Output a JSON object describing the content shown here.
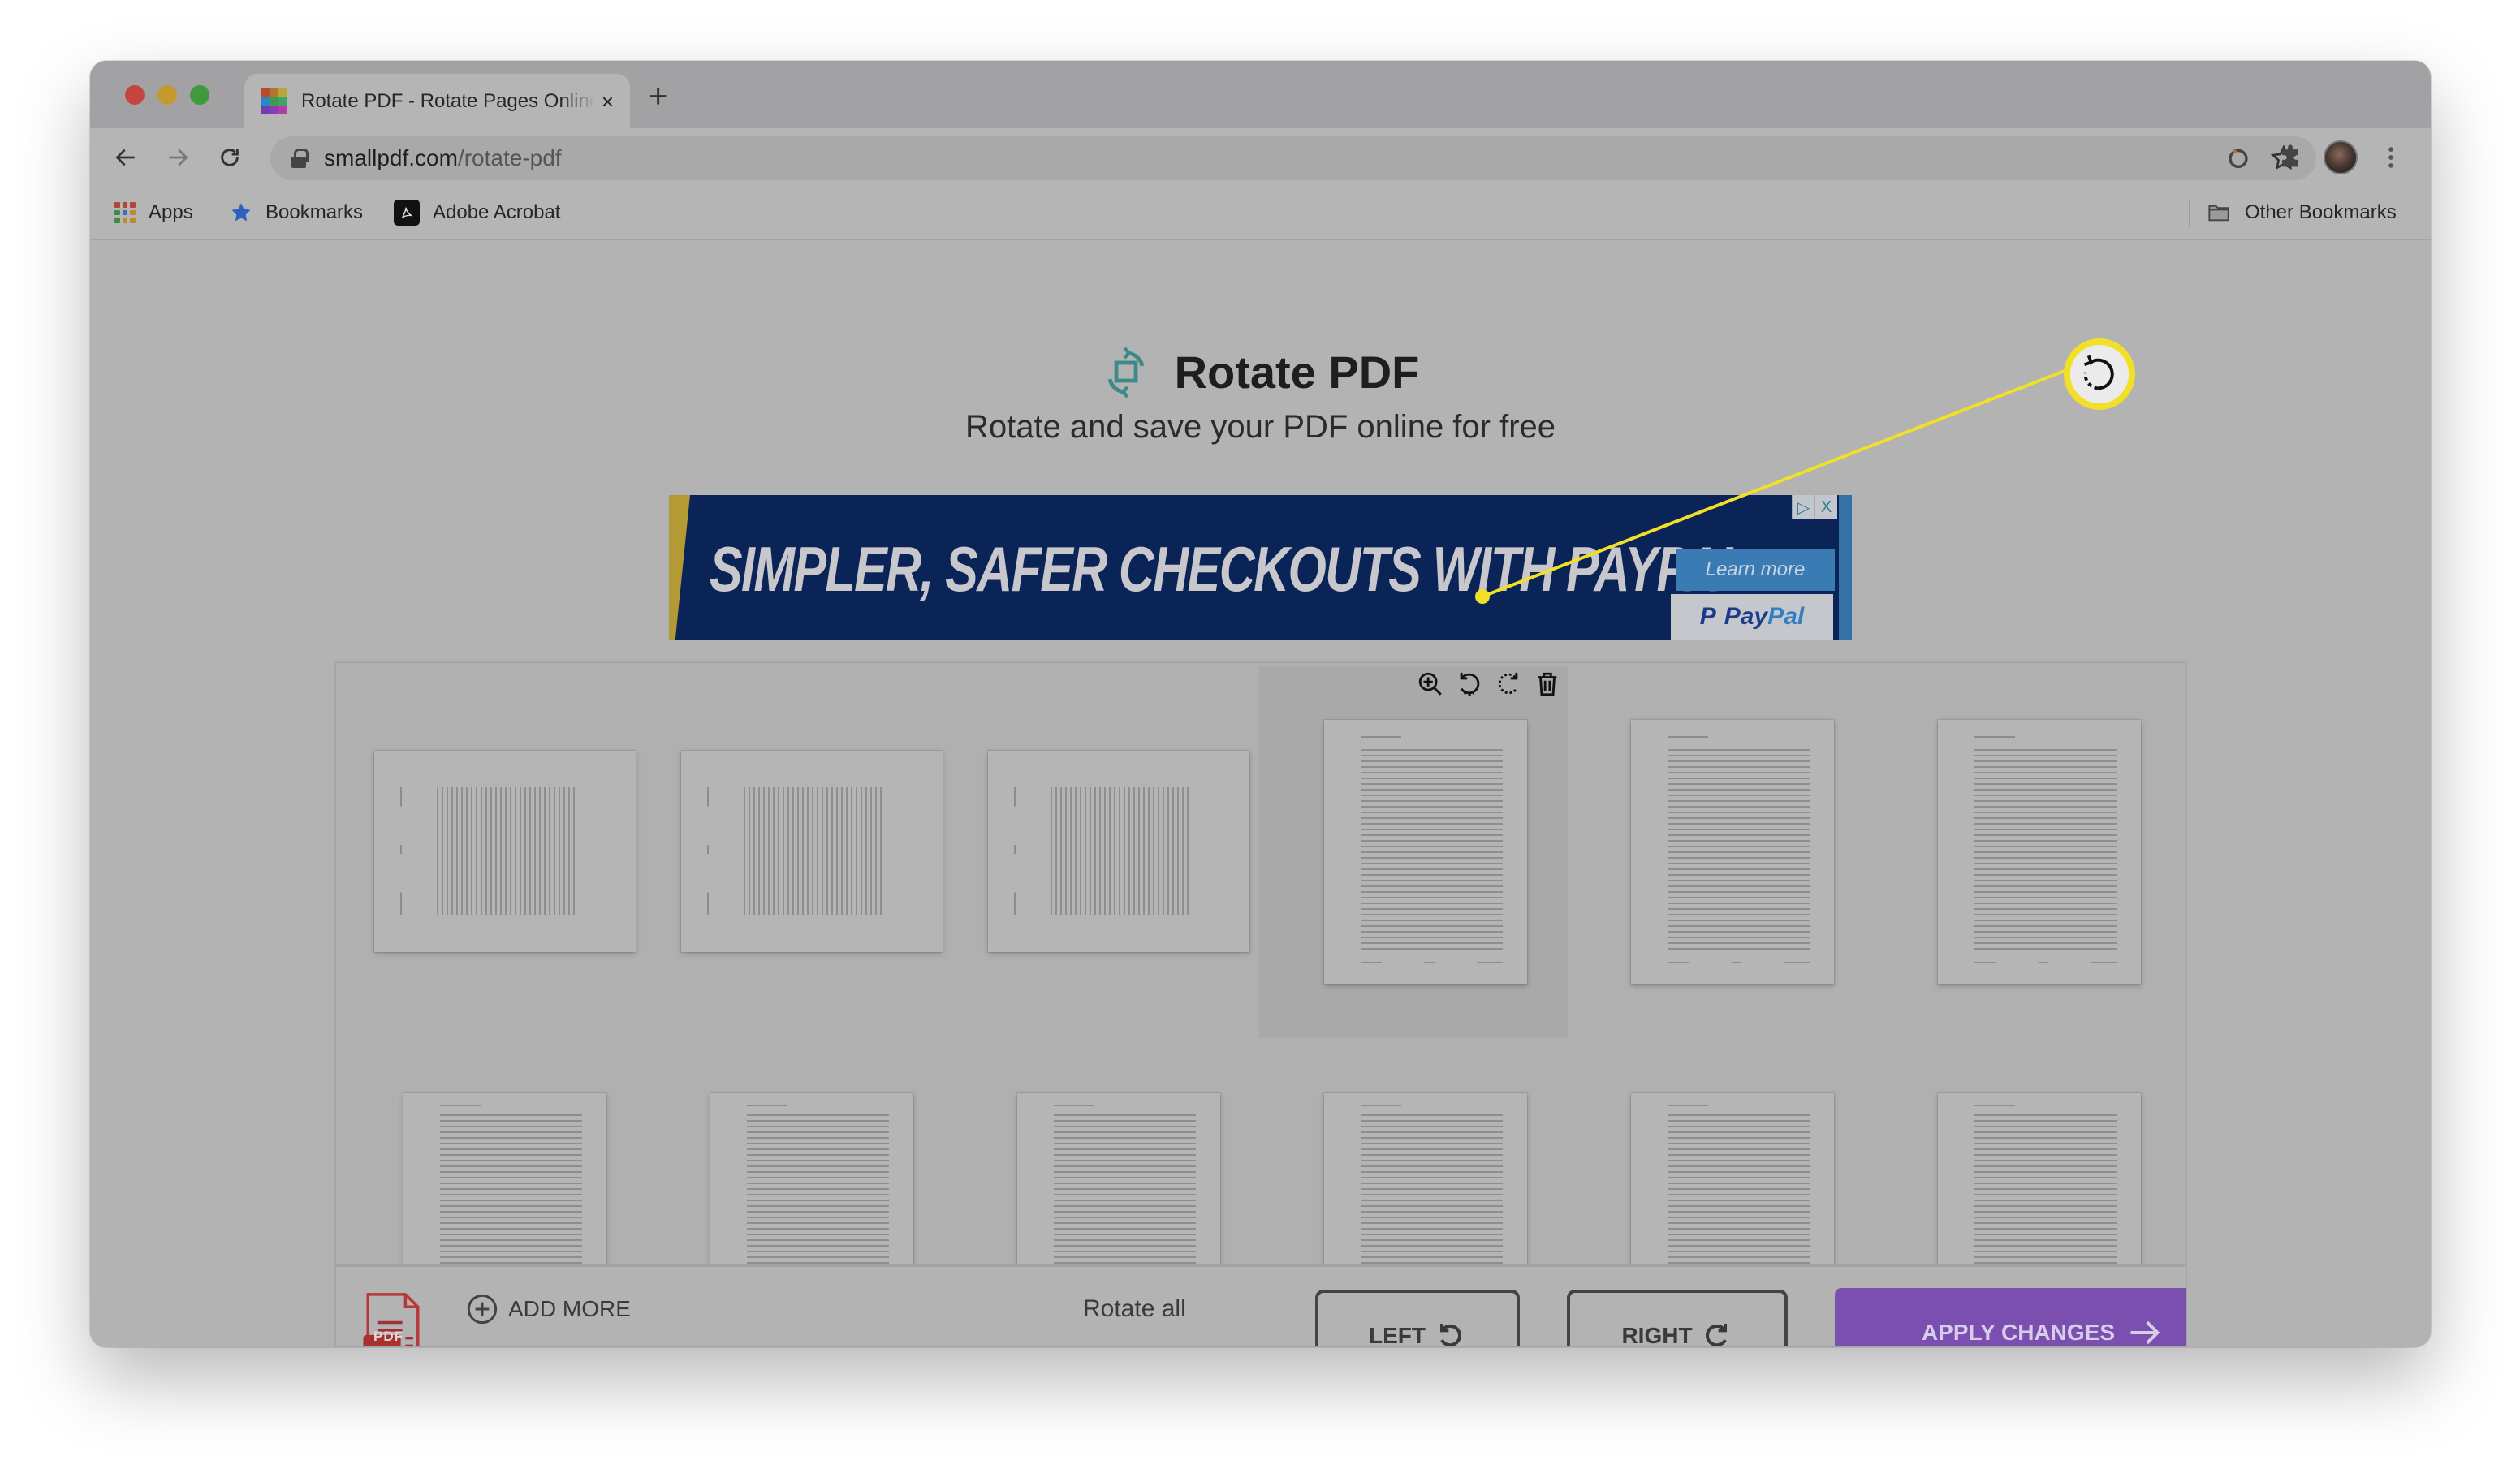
{
  "browser": {
    "tab": {
      "title": "Rotate PDF - Rotate Pages Online Free",
      "close_label": "×"
    },
    "new_tab_label": "+",
    "address": {
      "host": "smallpdf.com",
      "path": "/rotate-pdf"
    },
    "bookmarks": [
      {
        "label": "Apps",
        "icon": "apps-grid-icon"
      },
      {
        "label": "Bookmarks",
        "icon": "star-icon"
      },
      {
        "label": "Adobe Acrobat",
        "icon": "acrobat-icon"
      }
    ],
    "other_bookmarks": "Other Bookmarks"
  },
  "page": {
    "title": "Rotate PDF",
    "subtitle": "Rotate and save your PDF online for free",
    "title_icon": "rotate-document-icon",
    "accent_color": "#3c8a8a"
  },
  "ad": {
    "headline": "SIMPLER, SAFER CHECKOUTS WITH PAYPAL",
    "cta": "Learn more",
    "brand": "PayPal",
    "brand_pay": "Pay",
    "brand_pal": "Pal",
    "brand_mark": "P",
    "adchoices_label": "▷",
    "close_label": "X"
  },
  "editor": {
    "page_tools": [
      "zoom-in-icon",
      "rotate-left-icon",
      "rotate-right-icon",
      "trash-icon"
    ],
    "pages_row1": [
      {
        "orientation": "landscape"
      },
      {
        "orientation": "landscape"
      },
      {
        "orientation": "landscape"
      },
      {
        "orientation": "portrait",
        "hovered": true
      },
      {
        "orientation": "portrait"
      },
      {
        "orientation": "portrait"
      }
    ],
    "pages_row2": [
      {
        "orientation": "portrait"
      },
      {
        "orientation": "portrait"
      },
      {
        "orientation": "portrait"
      },
      {
        "orientation": "portrait"
      },
      {
        "orientation": "portrait"
      },
      {
        "orientation": "portrait"
      }
    ],
    "pdf_badge": "PDF",
    "add_more": "ADD MORE",
    "rotate_all": "Rotate all",
    "left": "LEFT",
    "right": "RIGHT",
    "apply": "APPLY CHANGES",
    "apply_color": "#7a4fb0"
  },
  "annotation": {
    "callout_icon": "rotate-left-icon",
    "color": "#f1e027"
  }
}
